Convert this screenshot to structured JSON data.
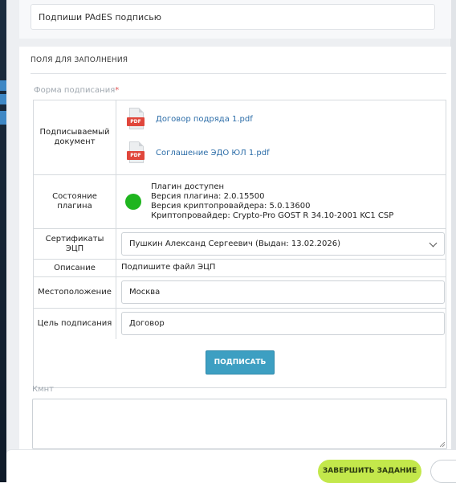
{
  "task": {
    "title": "Подпиши PAdES подписью"
  },
  "section": {
    "title": "ПОЛЯ ДЛЯ ЗАПОЛНЕНИЯ"
  },
  "form": {
    "label": "Форма подписания",
    "required_mark": "*",
    "rows": {
      "document": {
        "label": "Подписываемый документ",
        "files": [
          {
            "name": "Договор подряда 1.pdf",
            "icon": "pdf-file-icon",
            "tag": "PDF"
          },
          {
            "name": "Соглашение ЭДО ЮЛ 1.pdf",
            "icon": "pdf-file-icon",
            "tag": "PDF"
          }
        ]
      },
      "plugin": {
        "label": "Состояние плагина",
        "status_color": "#1fb51f",
        "lines": [
          "Плагин доступен",
          "Версия плагина: 2.0.15500",
          "Версия криптопровайдера: 5.0.13600",
          "Криптопровайдер: Crypto-Pro GOST R 34.10-2001 KC1 CSP"
        ]
      },
      "certificate": {
        "label": "Сертификаты ЭЦП",
        "value": "Пушкин Александ Сергеевич (Выдан: 13.02.2026)"
      },
      "description": {
        "label": "Описание",
        "value": "Подпишите файл ЭЦП"
      },
      "location": {
        "label": "Местоположение",
        "value": "Москва"
      },
      "purpose": {
        "label": "Цель подписания",
        "value": "Договор"
      }
    },
    "sign_button": "ПОДПИСАТЬ"
  },
  "comment": {
    "label": "Кмнт",
    "value": ""
  },
  "footer": {
    "finish_button": "ЗАВЕРШИТЬ ЗАДАНИЕ"
  },
  "colors": {
    "accent": "#3d9fc2",
    "finish": "#c3e84b",
    "link": "#2c6da8"
  }
}
